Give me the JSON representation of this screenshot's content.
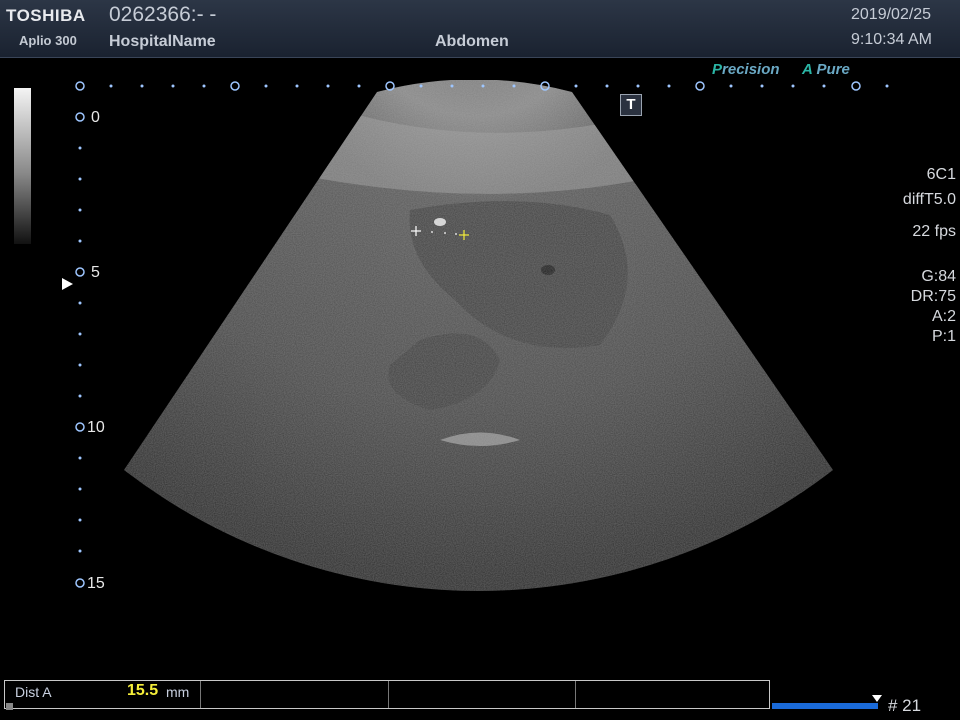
{
  "header": {
    "brand": "TOSHIBA",
    "model": "Aplio 300",
    "patient_id": "0262366:- -",
    "hospital": "HospitalName",
    "exam": "Abdomen",
    "date": "2019/02/25",
    "time": "9:10:34 AM"
  },
  "processing": {
    "precision_label": "Precision",
    "apure_a": "A",
    "apure_label": "Pure"
  },
  "depth_scale": {
    "labels": [
      "0",
      "5",
      "10",
      "15"
    ]
  },
  "t_marker_label": "T",
  "parameters": {
    "probe": "6C1",
    "preset": "diffT5.0",
    "fps": "22 fps",
    "gain": "G:84",
    "dynamic_range": "DR:75",
    "a": "A:2",
    "p": "P:1"
  },
  "measurement": {
    "label": "Dist A",
    "value": "15.5",
    "unit": "mm"
  },
  "cine": {
    "frame": "# 21"
  },
  "colors": {
    "header_bg": "#243041",
    "measurement_value": "#f5ee3a",
    "cine_bar": "#1a6ad8",
    "apure_accent": "#2bb6a6"
  }
}
